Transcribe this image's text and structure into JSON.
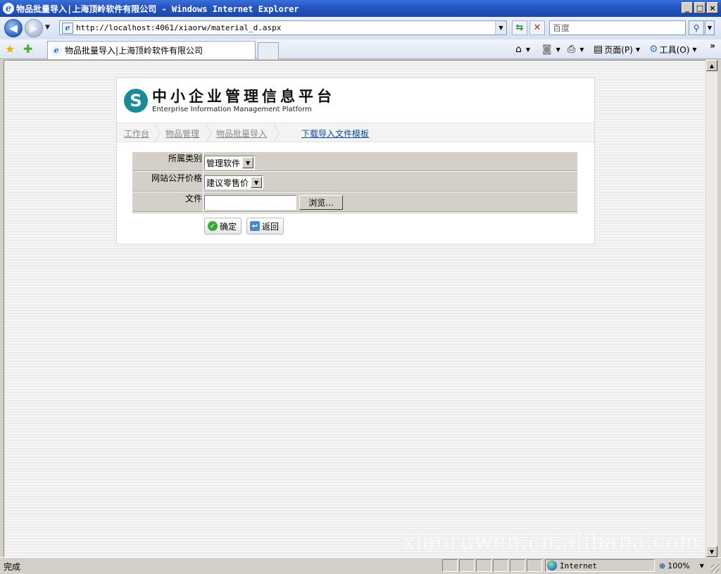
{
  "window": {
    "title": "物品批量导入|上海顶岭软件有限公司 - Windows Internet Explorer",
    "minimize": "_",
    "maximize": "□",
    "close": "×"
  },
  "toolbar": {
    "url": "http://localhost:4061/xiaorw/material_d.aspx",
    "search_placeholder": "百度",
    "tab_title": "物品批量导入|上海顶岭软件有限公司",
    "cmd_page": "页面(P)",
    "cmd_tools": "工具(O)"
  },
  "page": {
    "logo_cn": "中小企业管理信息平台",
    "logo_en": "Enterprise Information Management Platform",
    "breadcrumb": [
      "工作台",
      "物品管理",
      "物品批量导入"
    ],
    "download_link": "下载导入文件模板",
    "form": {
      "category_label": "所属类别",
      "category_value": "管理软件",
      "price_label": "网站公开价格",
      "price_value": "建议零售价",
      "file_label": "文件",
      "browse_label": "浏览..."
    },
    "confirm_button": "确定",
    "back_button": "返回",
    "watermark": "xiaoruwen.cn.alibaba.com"
  },
  "status": {
    "text": "完成",
    "zone": "Internet",
    "zoom": "100%"
  },
  "icons": [
    "ie-logo-icon",
    "back-arrow-icon",
    "forward-arrow-icon",
    "page-icon",
    "refresh-icon",
    "stop-icon",
    "search-icon",
    "favorites-star-icon",
    "add-favorites-icon",
    "home-icon",
    "feeds-icon",
    "print-icon",
    "page-menu-icon",
    "tools-gear-icon",
    "globe-icon",
    "zoom-icon",
    "check-icon",
    "return-icon"
  ]
}
